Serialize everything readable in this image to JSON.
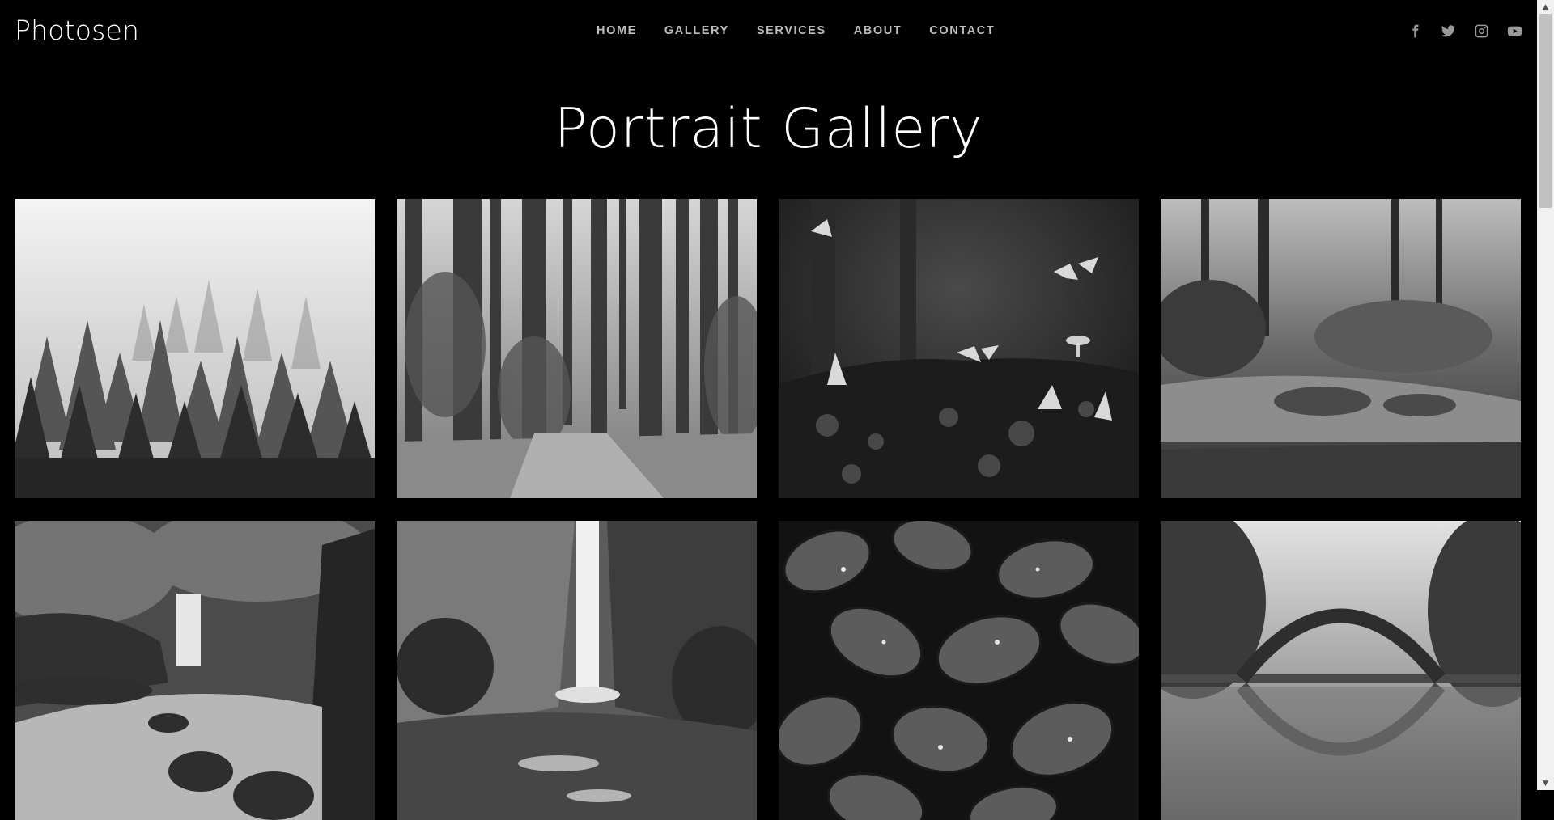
{
  "header": {
    "logo": "Photosen",
    "nav": [
      "HOME",
      "GALLERY",
      "SERVICES",
      "ABOUT",
      "CONTACT"
    ],
    "social": [
      "facebook-icon",
      "twitter-icon",
      "instagram-icon",
      "youtube-icon"
    ]
  },
  "page": {
    "title": "Portrait Gallery"
  },
  "gallery": {
    "images": [
      "misty-forest-photo",
      "tall-pine-forest-path-photo",
      "butterflies-mushrooms-photo",
      "forest-stream-rocks-photo",
      "waterfall-creek-photo",
      "tall-waterfall-canyon-photo",
      "wet-leaves-photo",
      "arch-bridge-reflection-photo"
    ]
  },
  "colors": {
    "background": "#000000",
    "text": "#ffffff",
    "nav": "#bdbdbd",
    "icon": "#9a9a9a"
  }
}
